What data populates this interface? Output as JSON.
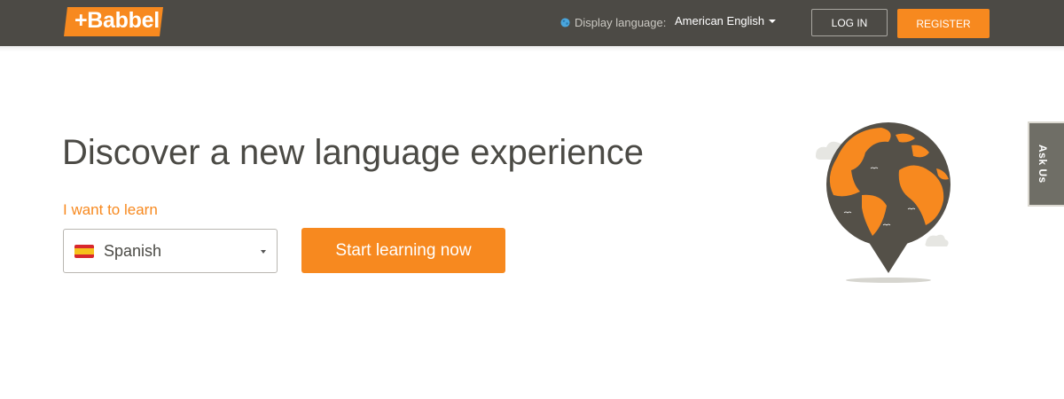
{
  "header": {
    "logo_text": "+Babbel",
    "display_language_label": "Display language:",
    "display_language_value": "American English",
    "login_label": "LOG IN",
    "register_label": "REGISTER"
  },
  "hero": {
    "headline": "Discover a new language experience",
    "learn_label": "I want to learn",
    "language_selected": "Spanish",
    "start_button_label": "Start learning now"
  },
  "side_tab": {
    "label": "Ask Us"
  },
  "icons": {
    "display_language": "globe-icon",
    "language_flag": "spain-flag-icon",
    "illustration": "world-map-pin-illustration"
  },
  "colors": {
    "header_bg": "#4c4a45",
    "accent_orange": "#f7891f",
    "text_dark": "#4b4a45",
    "globe_gray": "#545048",
    "tab_bg": "#6f6e66"
  }
}
